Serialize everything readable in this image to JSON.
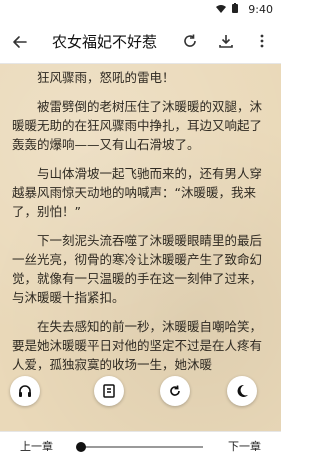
{
  "status_bar": {
    "time": "9:40"
  },
  "header": {
    "title": "农女福妃不好惹",
    "back_icon": "arrow-left-icon",
    "refresh_icon": "refresh-icon",
    "download_icon": "download-icon",
    "menu_icon": "more-vert-icon"
  },
  "chapter": {
    "paragraphs": [
      "狂风骤雨，怒吼的雷电！",
      "被雷劈倒的老树压住了沐暖暖的双腿，沐暖暖无助的在狂风骤雨中挣扎，耳边又响起了轰轰的爆响——又有山石滑坡了。",
      "与山体滑坡一起飞驰而来的，还有男人穿越暴风雨惊天动地的呐喊声：“沐暖暖，我来了，别怕！”",
      "下一刻泥头流吞噬了沐暖暖眼睛里的最后一丝光亮，彻骨的寒冷让沐暖暖产生了致命幻觉，就像有一只温暖的手在这一刻伸了过来，与沐暖暖十指紧扣。",
      "在失去感知的前一秒，沐暖暖自嘲哈笑，要是她沐暖暖平日对他的坚定不过是在人疼有人爱，孤独寂寞的收场一生，她沐暖"
    ]
  },
  "floating_buttons": [
    {
      "name": "headphones-icon"
    },
    {
      "name": "book-icon"
    },
    {
      "name": "rotate-icon"
    },
    {
      "name": "moon-icon"
    }
  ],
  "bottom_bar": {
    "prev_label": "上一章",
    "next_label": "下一章",
    "progress": 0.02
  }
}
